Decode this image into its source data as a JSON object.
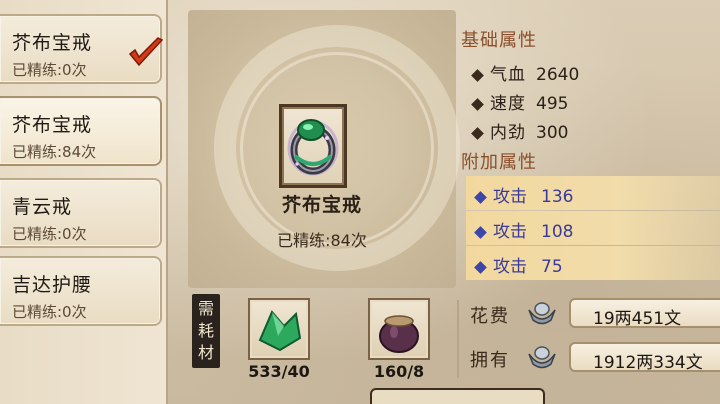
{
  "equipment_list": [
    {
      "name": "芥布宝戒",
      "refine": "已精练:0次",
      "selected": false
    },
    {
      "name": "芥布宝戒",
      "refine": "已精练:84次",
      "selected": true
    },
    {
      "name": "青云戒",
      "refine": "已精练:0次",
      "selected": false
    },
    {
      "name": "吉达护腰",
      "refine": "已精练:0次",
      "selected": false
    }
  ],
  "selected_item": {
    "name": "芥布宝戒",
    "refine": "已精练:84次",
    "icon": "green-jade-ring-icon"
  },
  "base_attributes": {
    "title": "基础属性",
    "stats": [
      {
        "label": "气血",
        "value": "2640"
      },
      {
        "label": "速度",
        "value": "495"
      },
      {
        "label": "内劲",
        "value": "300"
      }
    ]
  },
  "extra_attributes": {
    "title": "附加属性",
    "stats": [
      {
        "label": "攻击",
        "value": "136"
      },
      {
        "label": "攻击",
        "value": "108"
      },
      {
        "label": "攻击",
        "value": "75"
      }
    ]
  },
  "materials": {
    "label": "需耗材",
    "items": [
      {
        "icon": "green-crystal-icon",
        "count": "533/40"
      },
      {
        "icon": "powder-pot-icon",
        "count": "160/8"
      }
    ]
  },
  "cost": {
    "spend_label": "花费",
    "spend_value": "19两451文",
    "own_label": "拥有",
    "own_value": "1912两334文",
    "currency_icon": "silver-ingot-icon"
  },
  "colors": {
    "section_title": "#8b4f2a",
    "bonus_text": "#3a3a9a",
    "bonus_bg": "#f3d89e"
  }
}
